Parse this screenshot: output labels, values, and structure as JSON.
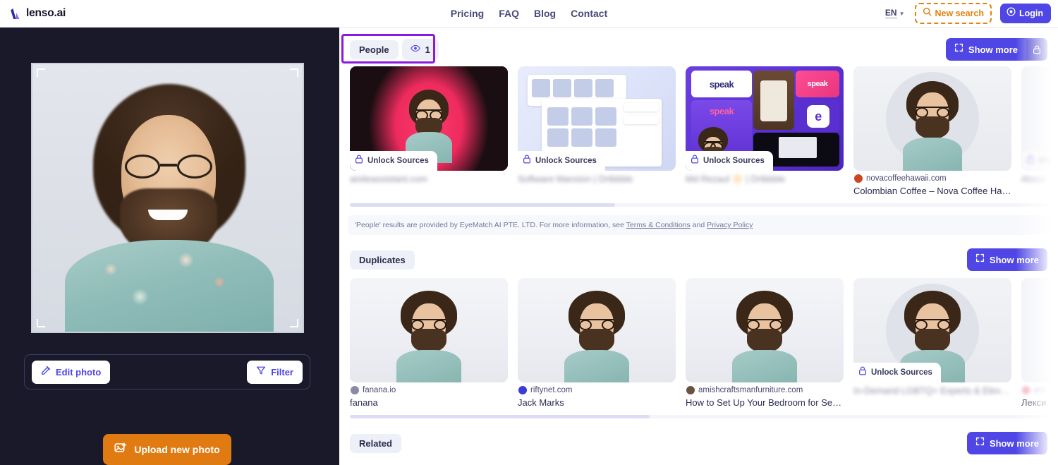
{
  "header": {
    "brand": "lenso.ai",
    "nav": [
      {
        "label": "Pricing"
      },
      {
        "label": "FAQ"
      },
      {
        "label": "Blog"
      },
      {
        "label": "Contact"
      }
    ],
    "language": "EN",
    "new_search_label": "New search",
    "login_label": "Login"
  },
  "sidebar": {
    "edit_photo_label": "Edit photo",
    "filter_label": "Filter",
    "upload_label": "Upload new photo"
  },
  "people_section": {
    "tab_label": "People",
    "view_count": "1",
    "show_more_label": "Show more",
    "disclaimer_prefix": "'People' results are provided by EyeMatch AI PTE. LTD. For more information, see ",
    "disclaimer_link_1": "Terms & Conditions",
    "disclaimer_mid": " and ",
    "disclaimer_link_2": "Privacy Policy",
    "scroll_percent": 38,
    "cards": [
      {
        "locked": true,
        "unlock_label": "Unlock Sources",
        "domain": "",
        "title": "aisiteassistant.com",
        "art": "pink"
      },
      {
        "locked": true,
        "unlock_label": "Unlock Sources",
        "domain": "",
        "title": "Software Mansion | Dribbble",
        "art": "ui"
      },
      {
        "locked": true,
        "unlock_label": "Unlock Sources",
        "domain": "",
        "title": "Md Rezaul 🔆 | Dribbble",
        "art": "speak"
      },
      {
        "locked": false,
        "unlock_label": "",
        "domain": "novacoffeehawaii.com",
        "title": "Colombian Coffee – Nova Coffee Hawaii",
        "art": "portrait"
      },
      {
        "locked": true,
        "unlock_label": "Unlock Sources",
        "domain": "",
        "title": "About",
        "art": "white"
      }
    ]
  },
  "duplicates_section": {
    "tab_label": "Duplicates",
    "show_more_label": "Show more",
    "scroll_percent": 43,
    "cards": [
      {
        "locked": false,
        "unlock_label": "",
        "domain": "fanana.io",
        "title": "fanana",
        "art": "studio"
      },
      {
        "locked": false,
        "unlock_label": "",
        "domain": "riftynet.com",
        "title": "Jack Marks",
        "art": "studio"
      },
      {
        "locked": false,
        "unlock_label": "",
        "domain": "amishcraftsmanfurniture.com",
        "title": "How to Set Up Your Bedroom for Serenit...",
        "art": "studio"
      },
      {
        "locked": true,
        "unlock_label": "Unlock Sources",
        "domain": "",
        "title": "In-Demand LGBTQ+ Experts & Elevated S...",
        "art": "portrait"
      },
      {
        "locked": false,
        "unlock_label": "",
        "domain": "pro",
        "title": "Лекси",
        "art": "white"
      }
    ]
  },
  "related_section": {
    "tab_label": "Related",
    "show_more_label": "Show more"
  },
  "colors": {
    "accent": "#4f46e5",
    "orange": "#e07b12",
    "highlight": "#8b19e0",
    "dark_sidebar": "#191929"
  },
  "icons": {
    "search": "search-icon",
    "eye": "eye-icon",
    "lock": "lock-icon",
    "expand": "expand-icon",
    "pencil": "pencil-icon",
    "funnel": "funnel-icon",
    "image_plus": "image-plus-icon",
    "user_circle": "user-circle-icon",
    "chevron_down": "chevron-down-icon"
  }
}
